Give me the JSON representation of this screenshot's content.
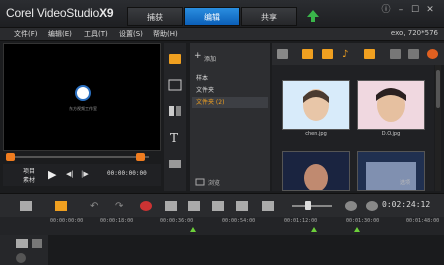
{
  "app": {
    "title_prefix": "Corel ",
    "title_main": "VideoStudio",
    "title_version": "X9"
  },
  "tabs": [
    {
      "label": "捕获"
    },
    {
      "label": "编辑"
    },
    {
      "label": "共享"
    }
  ],
  "menu": {
    "items": [
      "文件(F)",
      "编辑(E)",
      "工具(T)",
      "设置(S)",
      "帮助(H)"
    ],
    "resolution": "exo, 720*576"
  },
  "preview": {
    "logo_text": "东方视频工作室",
    "mode_label": "项目",
    "clip_label": "素材",
    "timecode": "00:00:00:00"
  },
  "library": {
    "add_label": "添加",
    "folders": [
      {
        "label": "样本",
        "selected": false
      },
      {
        "label": "文件夹",
        "selected": false
      },
      {
        "label": "文件夹 (2)",
        "selected": true
      }
    ],
    "browse_label": "浏览",
    "options_label": "选项",
    "thumbs": [
      {
        "caption": "chen.jpg"
      },
      {
        "caption": "D.O.jpg"
      },
      {
        "caption": ""
      },
      {
        "caption": ""
      }
    ]
  },
  "timeline": {
    "timecode": "0:02:24:12",
    "ruler": [
      "00:00:00:00",
      "00:00:18:00",
      "00:00:36:00",
      "00:00:54:00",
      "00:01:12:00",
      "00:01:30:00",
      "00:01:48:00"
    ]
  },
  "colors": {
    "accent": "#0b6fd0",
    "marker_orange": "#f07c1f",
    "selected_folder": "#f0a020",
    "marker_green": "#6ccf3a"
  }
}
